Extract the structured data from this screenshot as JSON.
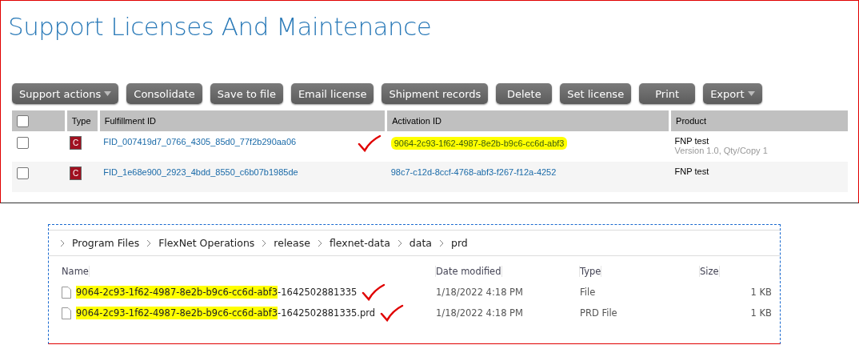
{
  "page": {
    "title": "Support Licenses And Maintenance"
  },
  "toolbar": [
    {
      "label": "Support actions",
      "dropdown": true
    },
    {
      "label": "Consolidate",
      "dropdown": false
    },
    {
      "label": "Save to file",
      "dropdown": false
    },
    {
      "label": "Email license",
      "dropdown": false
    },
    {
      "label": "Shipment records",
      "dropdown": false
    },
    {
      "label": "Delete",
      "dropdown": false
    },
    {
      "label": "Set license",
      "dropdown": false
    },
    {
      "label": "Print",
      "dropdown": false
    },
    {
      "label": "Export",
      "dropdown": true
    }
  ],
  "table": {
    "select_all_checked": false,
    "columns": [
      "Type",
      "Fulfillment ID",
      "Activation ID",
      "Product"
    ],
    "rows": [
      {
        "checked": false,
        "type_icon": "C",
        "fulfillment_id": "FID_007419d7_0766_4305_85d0_77f2b290aa06",
        "activation_id": "9064-2c93-1f62-4987-8e2b-b9c6-cc6d-abf3",
        "highlighted": true,
        "checkmark": true,
        "product": "FNP test",
        "product_detail": "Version 1.0, Qty/Copy 1"
      },
      {
        "checked": false,
        "type_icon": "C",
        "fulfillment_id": "FID_1e68e900_2923_4bdd_8550_c6b07b1985de",
        "activation_id": "98c7-c12d-8ccf-4768-abf3-f267-f12a-4252",
        "highlighted": false,
        "checkmark": false,
        "product": "FNP test"
      }
    ]
  },
  "explorer": {
    "breadcrumb": [
      "Program Files",
      "FlexNet Operations",
      "release",
      "flexnet-data",
      "data",
      "prd"
    ],
    "columns": [
      "Name",
      "Date modified",
      "Type",
      "Size"
    ],
    "files": [
      {
        "name_marked": "9064-2c93-1f62-4987-8e2b-b9c6-cc6d-abf3",
        "name_rest": "-1642502881335",
        "date": "1/18/2022 4:18 PM",
        "type": "File",
        "size": "1 KB",
        "checkmark": true
      },
      {
        "name_marked": "9064-2c93-1f62-4987-8e2b-b9c6-cc6d-abf3",
        "name_rest": "-1642502881335.prd",
        "date": "1/18/2022 4:18 PM",
        "type": "PRD File",
        "size": "1 KB",
        "checkmark": true
      }
    ]
  }
}
